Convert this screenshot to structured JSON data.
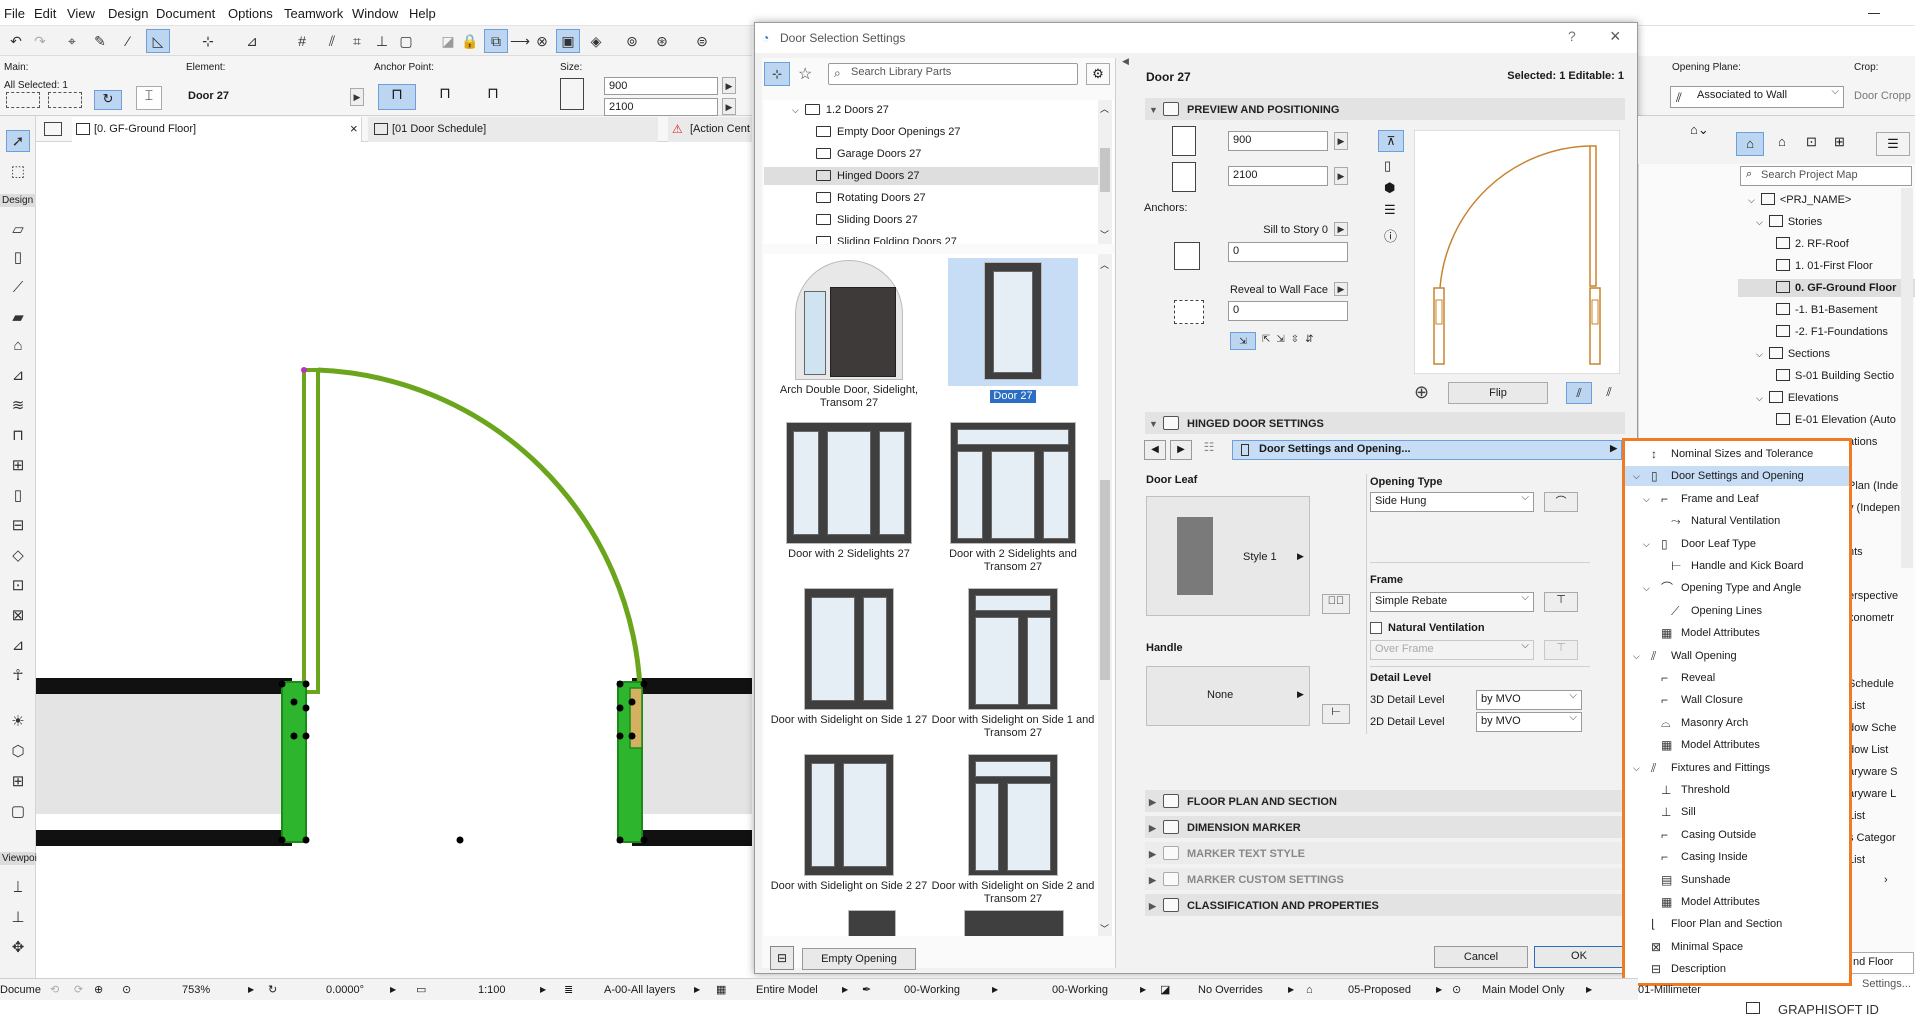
{
  "menu": [
    "File",
    "Edit",
    "View",
    "Design",
    "Document",
    "Options",
    "Teamwork",
    "Window",
    "Help"
  ],
  "infobox": {
    "main_label": "Main:",
    "all_selected": "All Selected: 1",
    "element_label": "Element:",
    "element_name": "Door 27",
    "anchor_label": "Anchor Point:",
    "size_label": "Size:",
    "width": "900",
    "height": "2100",
    "opening_plane_label": "Opening Plane:",
    "opening_plane_value": "Associated to Wall",
    "crop_label": "Crop:",
    "crop_value": "Door Cropp"
  },
  "tabs": [
    {
      "label": "[0. GF-Ground Floor]"
    },
    {
      "label": "[01 Door Schedule]"
    },
    {
      "label": "[Action Cent"
    }
  ],
  "toolbox": {
    "design_label": "Design",
    "viewpoint_label": "Viewpoi"
  },
  "dialog": {
    "title": "Door Selection Settings",
    "search_placeholder": "Search Library Parts",
    "tree": [
      {
        "label": "1.2 Doors 27"
      },
      {
        "label": "Empty Door Openings 27"
      },
      {
        "label": "Garage Doors 27"
      },
      {
        "label": "Hinged Doors 27"
      },
      {
        "label": "Rotating Doors 27"
      },
      {
        "label": "Sliding Doors 27"
      },
      {
        "label": "Sliding Folding Doors 27"
      }
    ],
    "library": [
      {
        "label": "Arch Double Door, Sidelight, Transom 27"
      },
      {
        "label": "Door 27"
      },
      {
        "label": "Door with 2 Sidelights 27"
      },
      {
        "label": "Door with 2 Sidelights and Transom 27"
      },
      {
        "label": "Door with Sidelight on Side 1 27"
      },
      {
        "label": "Door with Sidelight on Side 1 and Transom 27"
      },
      {
        "label": "Door with Sidelight on Side 2 27"
      },
      {
        "label": "Door with Sidelight on Side 2 and Transom 27"
      }
    ],
    "empty_opening": "Empty Opening",
    "header_name": "Door 27",
    "selected_info": "Selected: 1 Editable: 1",
    "preview_section": "PREVIEW AND POSITIONING",
    "width": "900",
    "height": "2100",
    "anchors_label": "Anchors:",
    "sill_label": "Sill to Story 0",
    "sill_value": "0",
    "reveal_label": "Reveal to Wall Face",
    "reveal_value": "0",
    "flip": "Flip",
    "hinged_section": "HINGED DOOR SETTINGS",
    "page_selector": "Door Settings and Opening...",
    "door_leaf_label": "Door Leaf",
    "door_leaf_style": "Style 1",
    "handle_label": "Handle",
    "handle_value": "None",
    "opening_type_label": "Opening Type",
    "opening_type_value": "Side Hung",
    "frame_label": "Frame",
    "frame_value": "Simple Rebate",
    "natural_vent_label": "Natural Ventilation",
    "over_frame_value": "Over Frame",
    "detail_level_label": "Detail Level",
    "detail_3d_label": "3D Detail Level",
    "detail_3d_value": "by MVO",
    "detail_2d_label": "2D Detail Level",
    "detail_2d_value": "by MVO",
    "sections": [
      {
        "label": "FLOOR PLAN AND SECTION"
      },
      {
        "label": "DIMENSION MARKER"
      },
      {
        "label": "MARKER TEXT STYLE"
      },
      {
        "label": "MARKER CUSTOM SETTINGS"
      },
      {
        "label": "CLASSIFICATION AND PROPERTIES"
      }
    ],
    "cancel": "Cancel",
    "ok": "OK"
  },
  "page_menu": [
    {
      "label": "Nominal Sizes and Tolerance"
    },
    {
      "label": "Door Settings and Opening"
    },
    {
      "label": "Frame and Leaf"
    },
    {
      "label": "Natural Ventilation"
    },
    {
      "label": "Door Leaf Type"
    },
    {
      "label": "Handle and Kick Board"
    },
    {
      "label": "Opening Type and Angle"
    },
    {
      "label": "Opening Lines"
    },
    {
      "label": "Model Attributes"
    },
    {
      "label": "Wall Opening"
    },
    {
      "label": "Reveal"
    },
    {
      "label": "Wall Closure"
    },
    {
      "label": "Masonry Arch"
    },
    {
      "label": "Model Attributes"
    },
    {
      "label": "Fixtures and Fittings"
    },
    {
      "label": "Threshold"
    },
    {
      "label": "Sill"
    },
    {
      "label": "Casing Outside"
    },
    {
      "label": "Casing Inside"
    },
    {
      "label": "Sunshade"
    },
    {
      "label": "Model Attributes"
    },
    {
      "label": "Floor Plan and Section"
    },
    {
      "label": "Minimal Space"
    },
    {
      "label": "Description"
    }
  ],
  "project_map": {
    "search_placeholder": "Search Project Map",
    "items": [
      {
        "label": "<PRJ_NAME>"
      },
      {
        "label": "Stories"
      },
      {
        "label": "2. RF-Roof"
      },
      {
        "label": "1. 01-First Floor"
      },
      {
        "label": "0. GF-Ground Floor"
      },
      {
        "label": "-1. B1-Basement"
      },
      {
        "label": "-2. F1-Foundations"
      },
      {
        "label": "Sections"
      },
      {
        "label": "S-01 Building Sectio"
      },
      {
        "label": "Elevations"
      },
      {
        "label": "E-01 Elevation (Auto"
      }
    ],
    "partial": [
      "ations",
      "Plan (Inde",
      "y (Indepen",
      "nts",
      "erspective",
      "xonometr",
      "Schedule",
      "List",
      "dow Sche",
      "dow List",
      "aryware S",
      "aryware L",
      "List",
      "s Categor",
      "List"
    ],
    "footer_partial": "nd Floor",
    "settings_partial": "Settings..."
  },
  "status": {
    "docume": "Docume",
    "zoom": "753%",
    "angle": "0.0000°",
    "scale": "1:100",
    "layers": "A-00-All layers",
    "model": "Entire Model",
    "working1": "00-Working",
    "working2": "00-Working",
    "overrides": "No Overrides",
    "proposed": "05-Proposed",
    "main_model": "Main Model Only",
    "millimeter": "01-Millimeter"
  },
  "graphisoft_id": "GRAPHISOFT ID",
  "colors": {
    "accent": "#f07b24",
    "door_green": "#2db52d",
    "arc_green": "#6aa51c",
    "selection": "#c7dcf5"
  }
}
